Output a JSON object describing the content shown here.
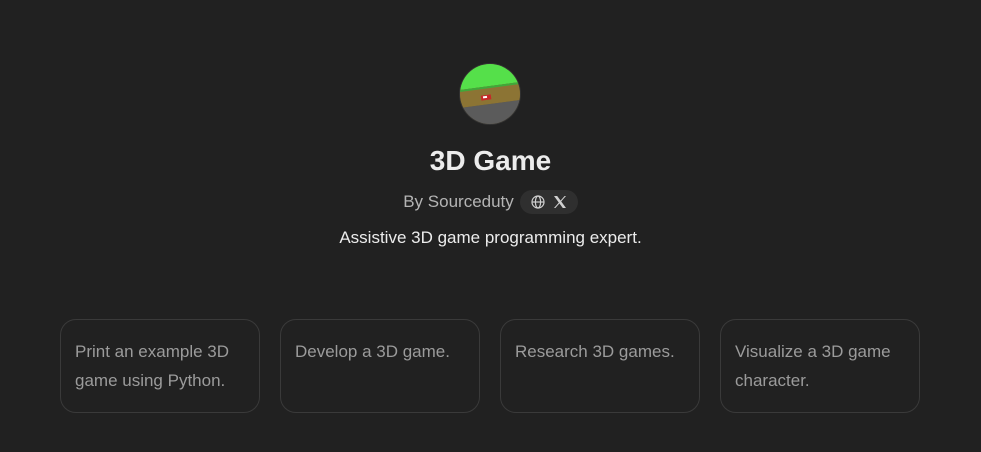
{
  "gpt": {
    "name": "3D Game",
    "byline": "By Sourceduty",
    "description": "Assistive 3D game programming expert.",
    "avatar_icon": "3d-game-scene-avatar",
    "link_icons": [
      "globe-icon",
      "x-logo-icon"
    ]
  },
  "starters": [
    {
      "text": "Print an example 3D game using Python."
    },
    {
      "text": "Develop a 3D game."
    },
    {
      "text": "Research 3D games."
    },
    {
      "text": "Visualize a 3D game character."
    }
  ],
  "colors": {
    "background": "#212121",
    "title": "#ececec",
    "muted": "#b4b4b4",
    "card_border": "#3a3a3a",
    "card_text": "#9b9b9b"
  }
}
